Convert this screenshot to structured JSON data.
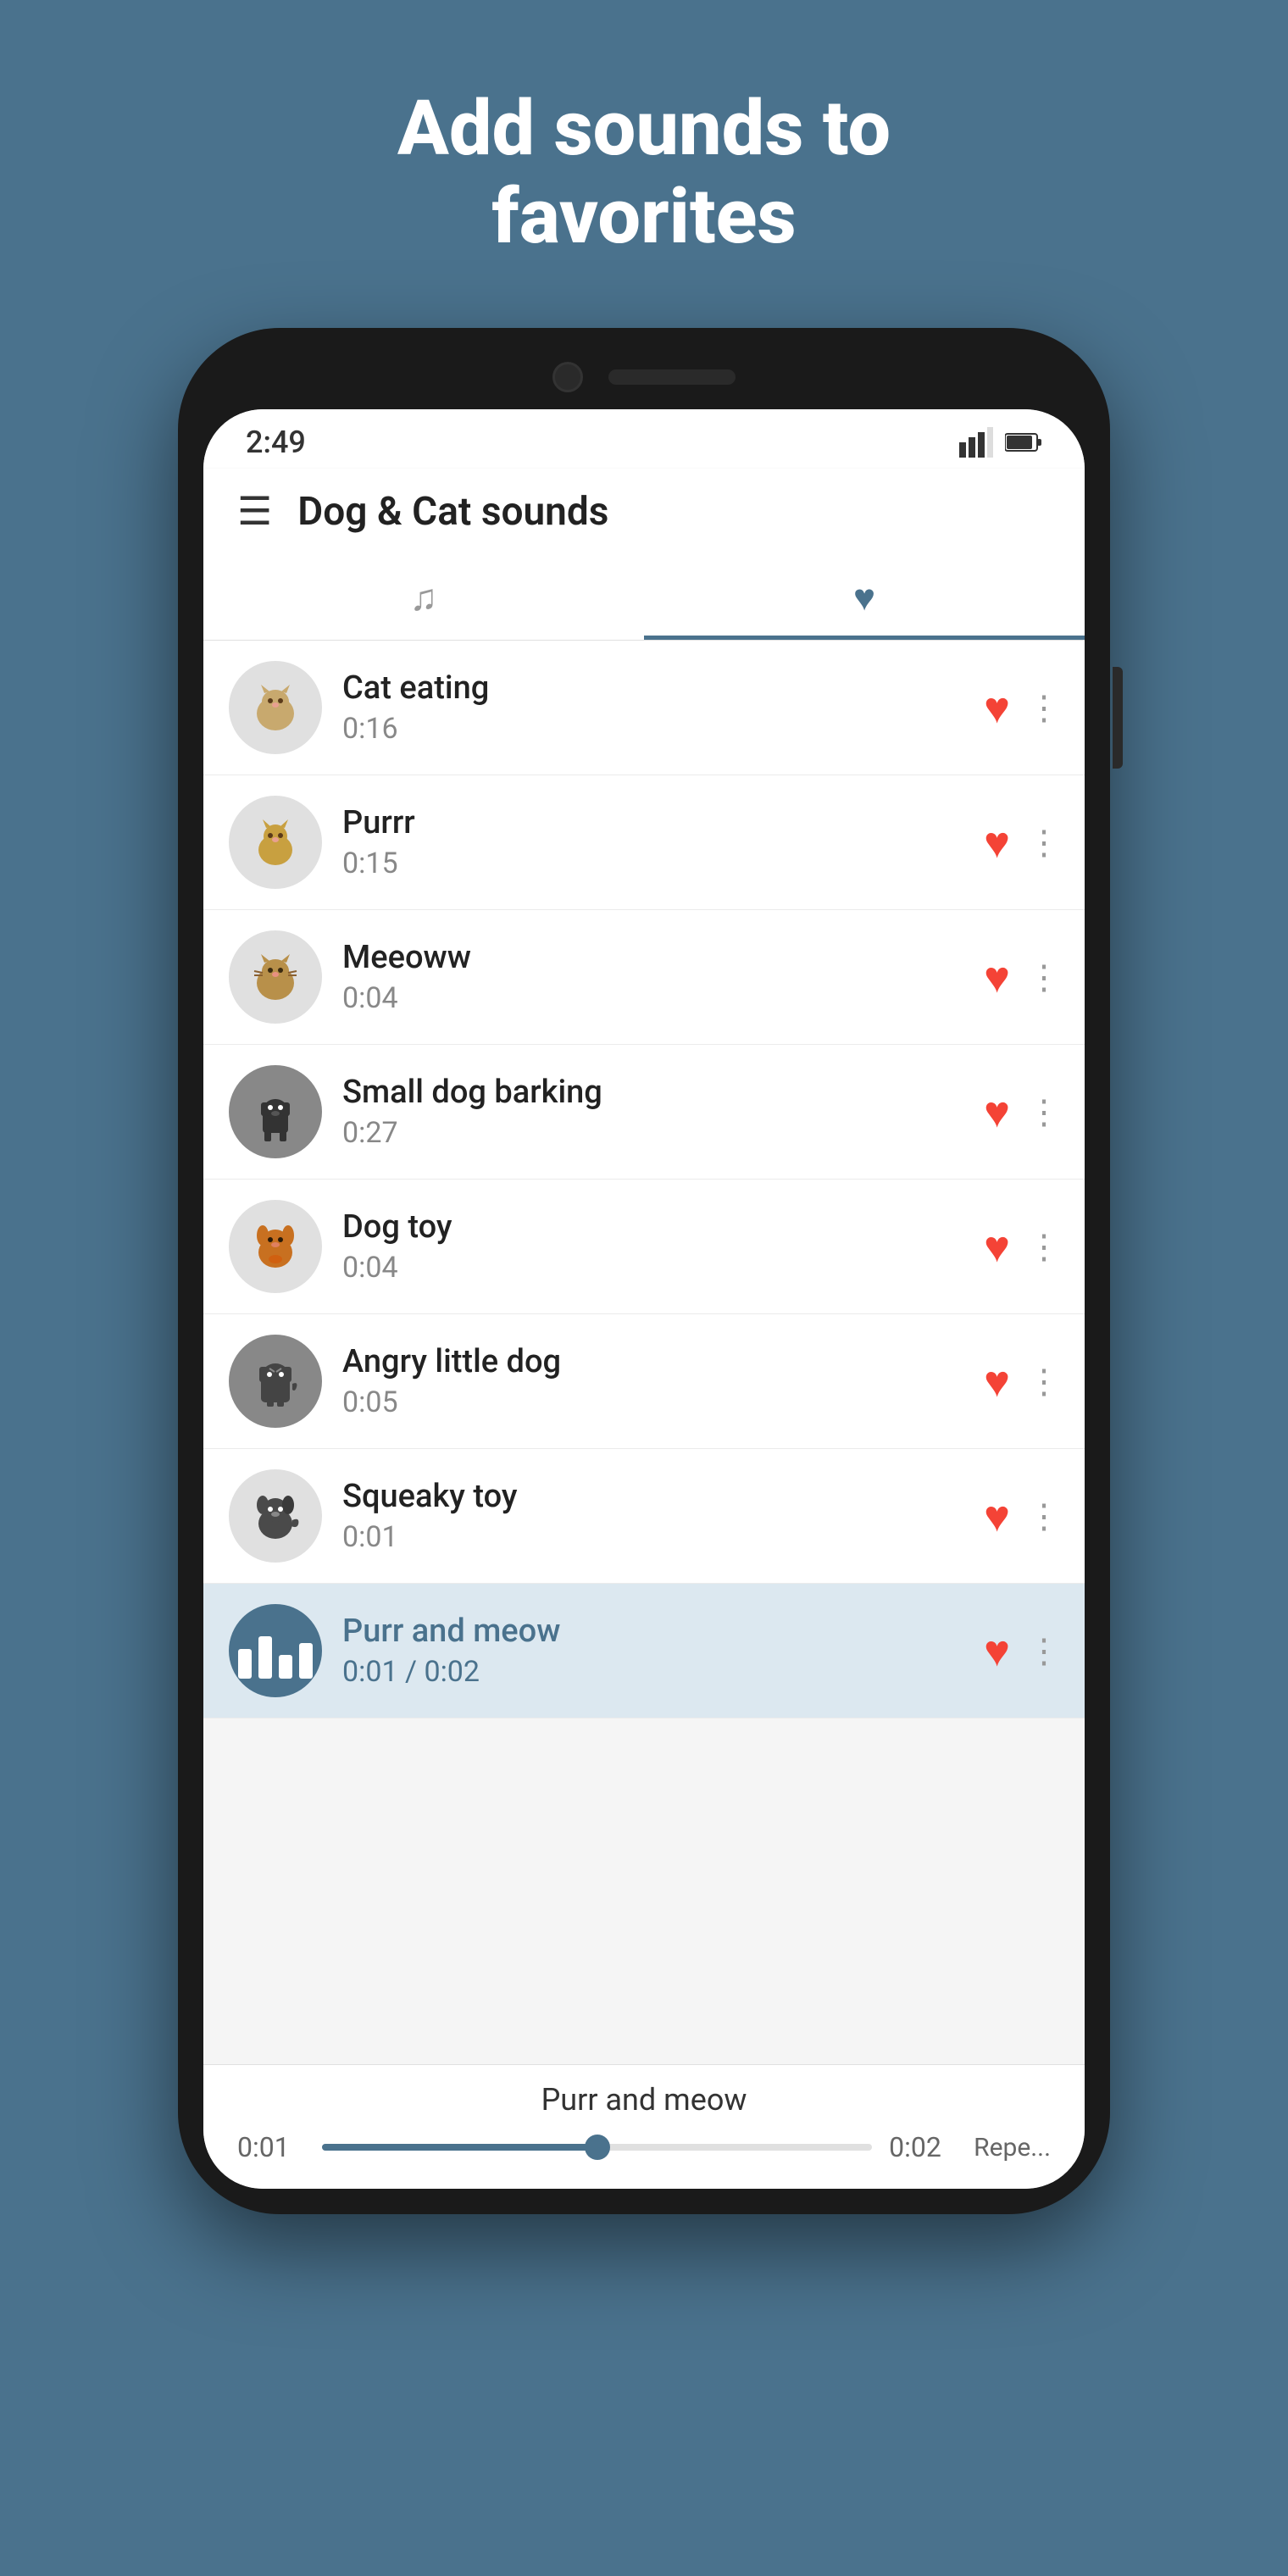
{
  "hero": {
    "title": "Add sounds to favorites"
  },
  "statusBar": {
    "time": "2:49",
    "signal": "▲",
    "battery": "🔋"
  },
  "appBar": {
    "title": "Dog & Cat sounds"
  },
  "tabs": [
    {
      "id": "sounds",
      "icon": "♩",
      "active": false
    },
    {
      "id": "favorites",
      "icon": "♥",
      "active": true
    }
  ],
  "soundList": [
    {
      "id": 1,
      "name": "Cat eating",
      "duration": "0:16",
      "emoji": "🐱",
      "darkBg": false,
      "favorited": true,
      "playing": false
    },
    {
      "id": 2,
      "name": "Purrr",
      "duration": "0:15",
      "emoji": "🐱",
      "darkBg": false,
      "favorited": true,
      "playing": false
    },
    {
      "id": 3,
      "name": "Meeoww",
      "duration": "0:04",
      "emoji": "🐱",
      "darkBg": false,
      "favorited": true,
      "playing": false
    },
    {
      "id": 4,
      "name": "Small dog barking",
      "duration": "0:27",
      "emoji": "🐕",
      "darkBg": true,
      "favorited": true,
      "playing": false
    },
    {
      "id": 5,
      "name": "Dog toy",
      "duration": "0:04",
      "emoji": "🐕",
      "darkBg": false,
      "favorited": true,
      "playing": false
    },
    {
      "id": 6,
      "name": "Angry little dog",
      "duration": "0:05",
      "emoji": "🐕",
      "darkBg": true,
      "favorited": true,
      "playing": false
    },
    {
      "id": 7,
      "name": "Squeaky toy",
      "duration": "0:01",
      "emoji": "🐕",
      "darkBg": false,
      "favorited": true,
      "playing": false
    },
    {
      "id": 8,
      "name": "Purr and meow",
      "duration": "0:01 / 0:02",
      "emoji": "🐱",
      "darkBg": false,
      "favorited": true,
      "playing": true
    }
  ],
  "bottomPlayer": {
    "title": "Purr and meow",
    "currentTime": "0:01",
    "totalTime": "0:02",
    "progressPercent": 50,
    "repeatLabel": "Repe..."
  }
}
